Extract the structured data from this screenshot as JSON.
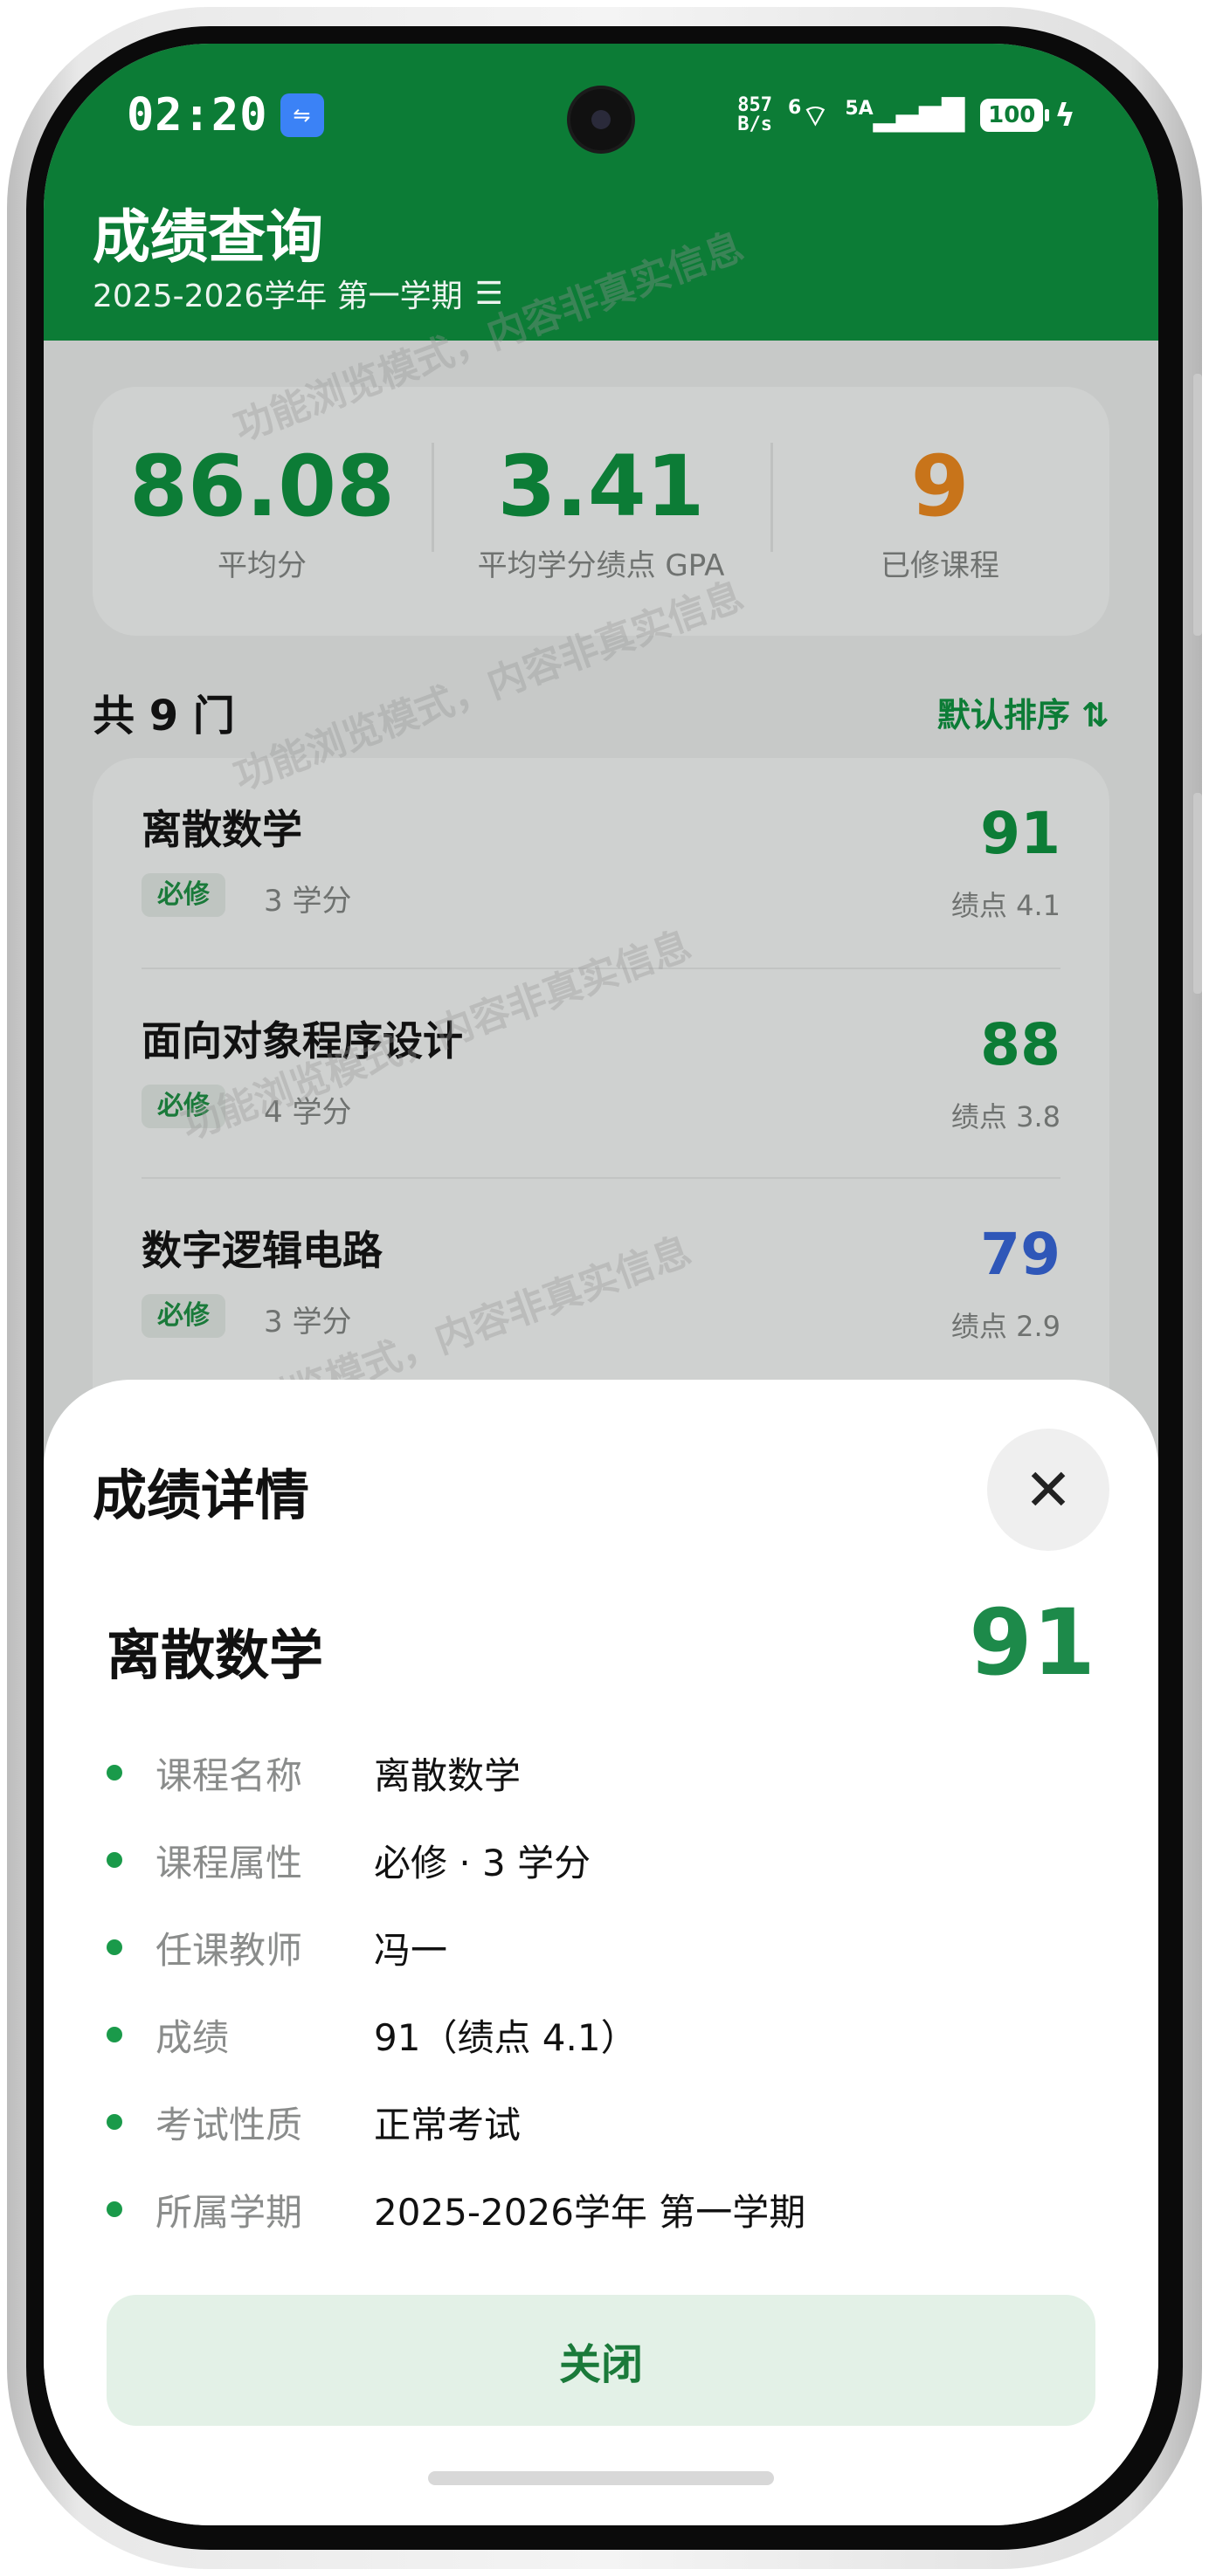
{
  "status": {
    "time": "02:20",
    "net_speed_value": "857",
    "net_speed_unit": "B/s",
    "wifi_label": "6",
    "signal_label": "5A",
    "battery": "100"
  },
  "header": {
    "title": "成绩查询",
    "term": "2025-2026学年 第一学期"
  },
  "summary": [
    {
      "value": "86.08",
      "label": "平均分",
      "color": "#0c7c36"
    },
    {
      "value": "3.41",
      "label": "平均学分绩点 GPA",
      "color": "#0c7c36"
    },
    {
      "value": "9",
      "label": "已修课程",
      "color": "#c8741a"
    }
  ],
  "list": {
    "count_label": "共 9 门",
    "sort_label": "默认排序 ⇅",
    "courses": [
      {
        "name": "离散数学",
        "tag": "必修",
        "credits": "3 学分",
        "score": "91",
        "gp": "绩点 4.1",
        "color": "#0c7c36"
      },
      {
        "name": "面向对象程序设计",
        "tag": "必修",
        "credits": "4 学分",
        "score": "88",
        "gp": "绩点 3.8",
        "color": "#0c7c36"
      },
      {
        "name": "数字逻辑电路",
        "tag": "必修",
        "credits": "3 学分",
        "score": "79",
        "gp": "绩点 2.9",
        "color": "#2f57b8"
      }
    ]
  },
  "watermark_text": "功能浏览模式，内容非真实信息",
  "sheet": {
    "title": "成绩详情",
    "course_name": "离散数学",
    "score": "91",
    "details": [
      {
        "label": "课程名称",
        "value": "离散数学"
      },
      {
        "label": "课程属性",
        "value": "必修 · 3 学分"
      },
      {
        "label": "任课教师",
        "value": "冯一"
      },
      {
        "label": "成绩",
        "value": "91（绩点 4.1）"
      },
      {
        "label": "考试性质",
        "value": "正常考试"
      },
      {
        "label": "所属学期",
        "value": "2025-2026学年 第一学期"
      }
    ],
    "close_label": "关闭"
  }
}
